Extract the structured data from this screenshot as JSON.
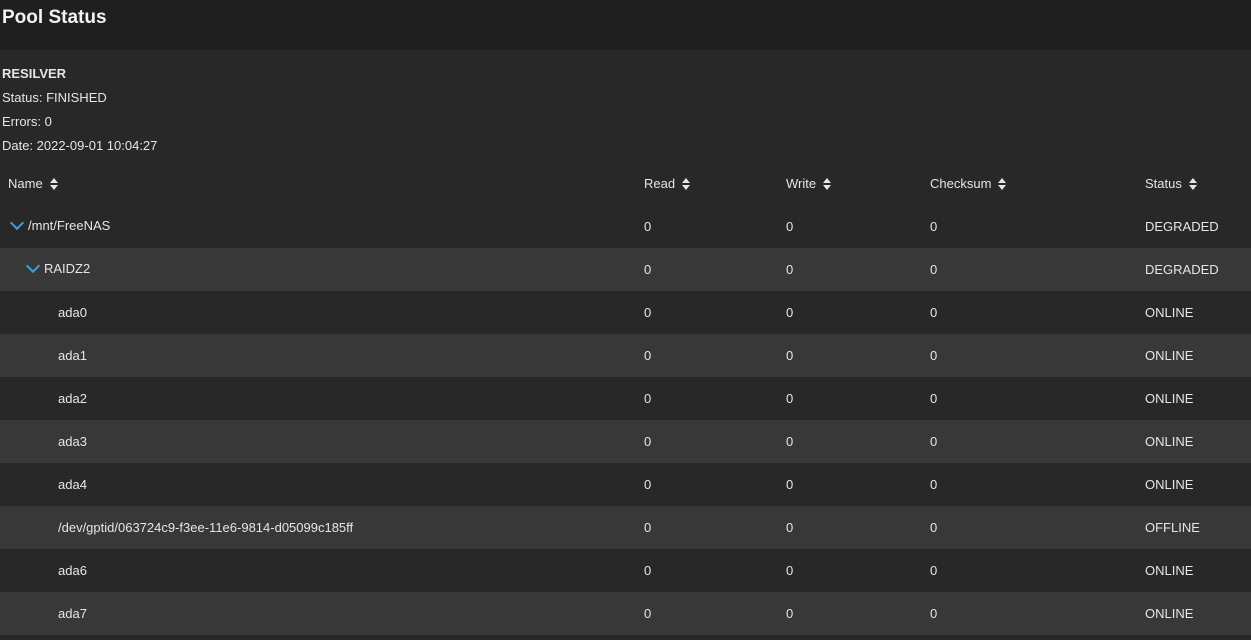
{
  "page": {
    "title": "Pool Status"
  },
  "scan": {
    "type": "RESILVER",
    "status": "Status: FINISHED",
    "errors": "Errors: 0",
    "date": "Date: 2022-09-01 10:04:27"
  },
  "table": {
    "columns": [
      "Name",
      "Read",
      "Write",
      "Checksum",
      "Status"
    ],
    "rows": [
      {
        "name": "/mnt/FreeNAS",
        "read": "0",
        "write": "0",
        "checksum": "0",
        "status": "DEGRADED",
        "level": 0,
        "expanded": true
      },
      {
        "name": "RAIDZ2",
        "read": "0",
        "write": "0",
        "checksum": "0",
        "status": "DEGRADED",
        "level": 1,
        "expanded": true
      },
      {
        "name": "ada0",
        "read": "0",
        "write": "0",
        "checksum": "0",
        "status": "ONLINE",
        "level": 2
      },
      {
        "name": "ada1",
        "read": "0",
        "write": "0",
        "checksum": "0",
        "status": "ONLINE",
        "level": 2
      },
      {
        "name": "ada2",
        "read": "0",
        "write": "0",
        "checksum": "0",
        "status": "ONLINE",
        "level": 2
      },
      {
        "name": "ada3",
        "read": "0",
        "write": "0",
        "checksum": "0",
        "status": "ONLINE",
        "level": 2
      },
      {
        "name": "ada4",
        "read": "0",
        "write": "0",
        "checksum": "0",
        "status": "ONLINE",
        "level": 2
      },
      {
        "name": "/dev/gptid/063724c9-f3ee-11e6-9814-d05099c185ff",
        "read": "0",
        "write": "0",
        "checksum": "0",
        "status": "OFFLINE",
        "level": 2
      },
      {
        "name": "ada6",
        "read": "0",
        "write": "0",
        "checksum": "0",
        "status": "ONLINE",
        "level": 2
      },
      {
        "name": "ada7",
        "read": "0",
        "write": "0",
        "checksum": "0",
        "status": "ONLINE",
        "level": 2
      }
    ]
  },
  "icons": {
    "sort": "sort-icon",
    "expand": "chevron-down-icon"
  },
  "colors": {
    "accent": "#3aa0dc",
    "background": "#282828",
    "row_alt": "#383838"
  }
}
